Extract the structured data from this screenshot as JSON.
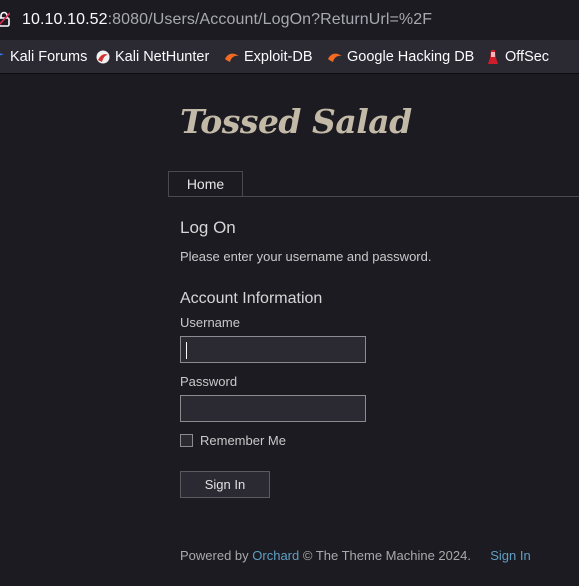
{
  "browser": {
    "url_host": "10.10.10.52",
    "url_rest": ":8080/Users/Account/LogOn?ReturnUrl=%2F",
    "bookmarks": [
      {
        "label": "Kali Forums",
        "icon": "kali-dragon-icon"
      },
      {
        "label": "Kali NetHunter",
        "icon": "nethunter-icon"
      },
      {
        "label": "Exploit-DB",
        "icon": "exploit-db-icon"
      },
      {
        "label": "Google Hacking DB",
        "icon": "ghdb-icon"
      },
      {
        "label": "OffSec",
        "icon": "offsec-icon"
      }
    ]
  },
  "site": {
    "title": "Tossed Salad",
    "nav": {
      "home": "Home"
    }
  },
  "logon": {
    "heading": "Log On",
    "intro": "Please enter your username and password.",
    "section_heading": "Account Information",
    "username_label": "Username",
    "username_value": "",
    "password_label": "Password",
    "password_value": "",
    "remember_label": "Remember Me",
    "remember_checked": false,
    "submit_label": "Sign In"
  },
  "footer": {
    "powered_by": "Powered by",
    "orchard": "Orchard",
    "copyright": "© The Theme Machine 2024.",
    "sign_in": "Sign In"
  },
  "colors": {
    "background": "#1c1b22",
    "title": "#c2b9a6",
    "link": "#5f9fc4"
  }
}
